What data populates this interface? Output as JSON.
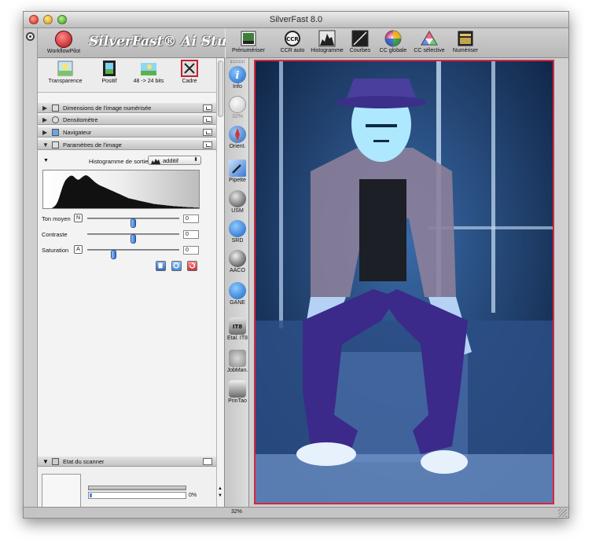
{
  "window": {
    "title": "SilverFast 8.0"
  },
  "brand": {
    "workflow_label": "WorkflowPilot",
    "logo": "SilverFast® Ai Studio"
  },
  "toolbar": {
    "items": [
      {
        "label": "Prénumériser",
        "icon": "prescan-icon"
      },
      {
        "label": "CCR auto",
        "icon": "auto-ccr-icon"
      },
      {
        "label": "Histogramme",
        "icon": "histogram-icon"
      },
      {
        "label": "Courbes",
        "icon": "curves-icon"
      },
      {
        "label": "CC globale",
        "icon": "global-color-icon"
      },
      {
        "label": "CC sélective",
        "icon": "selective-color-icon"
      },
      {
        "label": "Numériser",
        "icon": "scan-icon"
      }
    ]
  },
  "frame_functions": {
    "items": [
      {
        "label": "Transparence",
        "icon": "transparency-icon"
      },
      {
        "label": "Positif",
        "icon": "film-positive-icon"
      },
      {
        "label": "48 -> 24 bits",
        "icon": "bit-depth-icon"
      },
      {
        "label": "Cadre",
        "icon": "frame-icon"
      }
    ]
  },
  "panels": {
    "dimensions": "Dimensions de l'image numérisée",
    "densitometer": "Densitomètre",
    "navigator": "Navigateur",
    "image_params": "Paramètres de l'image"
  },
  "histogram": {
    "label": "Histogramme de sortie",
    "mode": "additif",
    "levels": [
      0,
      1,
      1,
      2,
      3,
      4,
      6,
      9,
      14,
      22,
      34,
      48,
      62,
      74,
      83,
      88,
      92,
      95,
      96,
      94,
      90,
      86,
      84,
      86,
      90,
      93,
      96,
      97,
      95,
      92,
      88,
      84,
      80,
      76,
      73,
      70,
      68,
      66,
      64,
      62,
      60,
      58,
      56,
      54,
      52,
      50,
      48,
      46,
      44,
      42,
      40,
      38,
      36,
      34,
      32,
      31,
      30,
      29,
      28,
      27,
      26,
      25,
      24,
      23,
      22,
      21,
      20,
      19,
      18,
      17,
      16,
      16,
      15,
      15,
      14,
      14,
      13,
      13,
      12,
      12,
      11,
      11,
      10,
      10,
      10,
      9,
      9,
      9,
      8,
      8,
      8,
      7,
      7,
      7,
      7,
      6,
      6,
      6,
      6,
      5
    ]
  },
  "sliders": [
    {
      "label": "Ton moyen",
      "key": "N",
      "value": "0",
      "position": 0.5
    },
    {
      "label": "Contraste",
      "key": "",
      "value": "0",
      "position": 0.5
    },
    {
      "label": "Saturation",
      "key": "A",
      "value": "0",
      "position": 0.27
    }
  ],
  "scanner": {
    "title": "Etat du scanner",
    "progress_text": "0%",
    "progress": 0.0
  },
  "side_tools": [
    {
      "label": "Info",
      "icon": "info-icon",
      "interactable": true,
      "color": "#2f86d6"
    },
    {
      "label": "32%",
      "icon": "zoom-icon",
      "interactable": false,
      "color": "#cfcfcf"
    },
    {
      "label": "Orient.",
      "icon": "orientation-icon",
      "interactable": true,
      "color": "#3f78c8"
    },
    {
      "label": "Pipette",
      "icon": "pipette-icon",
      "interactable": true,
      "color": "#5a8fd8"
    },
    {
      "label": "USM",
      "icon": "usm-icon",
      "interactable": true,
      "color": "#3a3a3a"
    },
    {
      "label": "SRD",
      "icon": "srd-icon",
      "interactable": true,
      "color": "#2e82d2"
    },
    {
      "label": "AACO",
      "icon": "aaco-icon",
      "interactable": true,
      "color": "#2a2a2a"
    },
    {
      "label": "GANE",
      "icon": "gane-icon",
      "interactable": true,
      "color": "#2576c6"
    },
    {
      "label": "Etal. IT8",
      "icon": "it8-icon",
      "interactable": true,
      "color": "#777777"
    },
    {
      "label": "JobMan.",
      "icon": "job-manager-icon",
      "interactable": true,
      "color": "#9c9c9c"
    },
    {
      "label": "PrinTao",
      "icon": "printao-icon",
      "interactable": true,
      "color": "#555555"
    }
  ],
  "status": {
    "zoom": "32%"
  },
  "colors": {
    "frame": "#d8263c",
    "accent_blue": "#2e6fd4",
    "logo_red": "#b10c14"
  }
}
